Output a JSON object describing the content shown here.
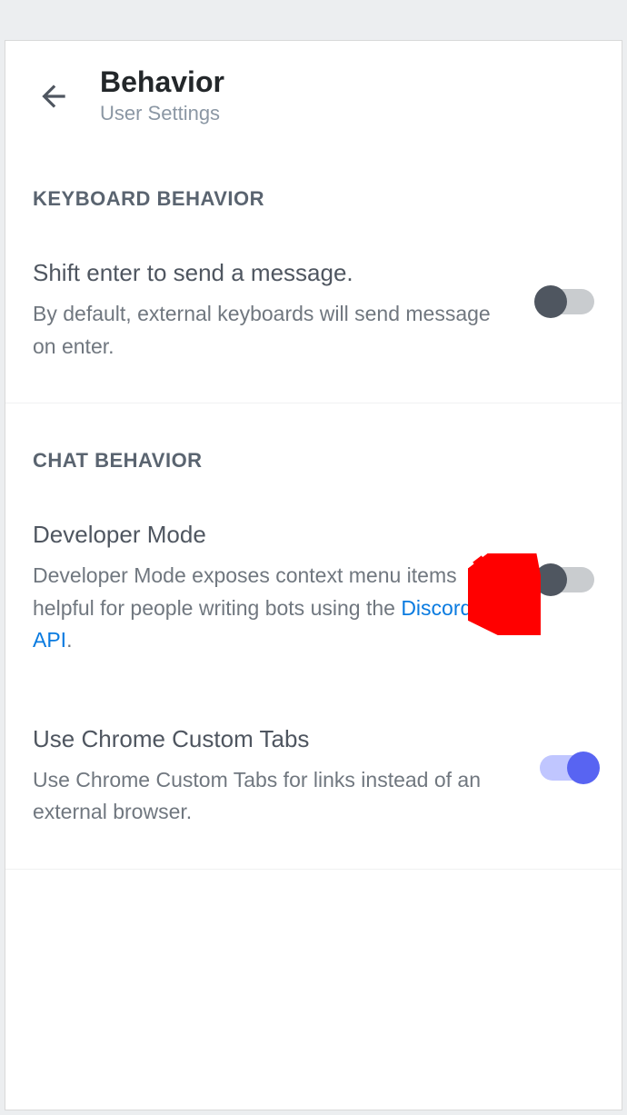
{
  "header": {
    "title": "Behavior",
    "subtitle": "User Settings"
  },
  "sections": {
    "keyboard": {
      "heading": "KEYBOARD BEHAVIOR",
      "shift_enter": {
        "title": "Shift enter to send a message.",
        "desc": "By default, external keyboards will send message on enter.",
        "enabled": false
      }
    },
    "chat": {
      "heading": "CHAT BEHAVIOR",
      "developer_mode": {
        "title": "Developer Mode",
        "desc_pre": "Developer Mode exposes context menu items helpful for people writing bots using the ",
        "link_text": "Discord API",
        "desc_post": ".",
        "enabled": false
      },
      "chrome_tabs": {
        "title": "Use Chrome Custom Tabs",
        "desc": "Use Chrome Custom Tabs for links instead of an external browser.",
        "enabled": true
      }
    }
  }
}
